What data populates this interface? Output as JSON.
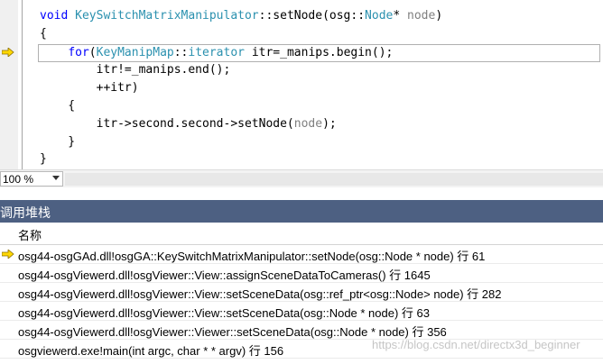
{
  "editor": {
    "lines": [
      [
        [
          "k",
          "void"
        ],
        [
          "t",
          " "
        ],
        [
          "ty",
          "KeySwitchMatrixManipulator"
        ],
        [
          "t",
          "::setNode(osg::"
        ],
        [
          "ty",
          "Node"
        ],
        [
          "t",
          "* "
        ],
        [
          "pa",
          "node"
        ],
        [
          "t",
          ")"
        ]
      ],
      [
        [
          "t",
          "{"
        ]
      ],
      [
        [
          "t",
          "    "
        ],
        [
          "k",
          "for"
        ],
        [
          "t",
          "("
        ],
        [
          "ty",
          "KeyManipMap"
        ],
        [
          "t",
          "::"
        ],
        [
          "ty",
          "iterator"
        ],
        [
          "t",
          " itr=_manips.begin();"
        ]
      ],
      [
        [
          "t",
          "        itr!=_manips.end();"
        ]
      ],
      [
        [
          "t",
          "        ++itr)"
        ]
      ],
      [
        [
          "t",
          "    {"
        ]
      ],
      [
        [
          "t",
          "        itr->second.second->setNode("
        ],
        [
          "pa",
          "node"
        ],
        [
          "t",
          ");"
        ]
      ],
      [
        [
          "t",
          "    }"
        ]
      ],
      [
        [
          "t",
          "}"
        ]
      ]
    ]
  },
  "zoom": {
    "value": "100 %"
  },
  "callstack": {
    "title": "调用堆栈",
    "column_name": "名称",
    "rows": [
      "osg44-osgGAd.dll!osgGA::KeySwitchMatrixManipulator::setNode(osg::Node * node) 行 61",
      "osg44-osgViewerd.dll!osgViewer::View::assignSceneDataToCameras() 行 1645",
      "osg44-osgViewerd.dll!osgViewer::View::setSceneData(osg::ref_ptr<osg::Node> node) 行 282",
      "osg44-osgViewerd.dll!osgViewer::View::setSceneData(osg::Node * node) 行 63",
      "osg44-osgViewerd.dll!osgViewer::Viewer::setSceneData(osg::Node * node) 行 356",
      "osgviewerd.exe!main(int argc, char * * argv) 行 156"
    ]
  },
  "watermark": "https://blog.csdn.net/directx3d_beginner"
}
